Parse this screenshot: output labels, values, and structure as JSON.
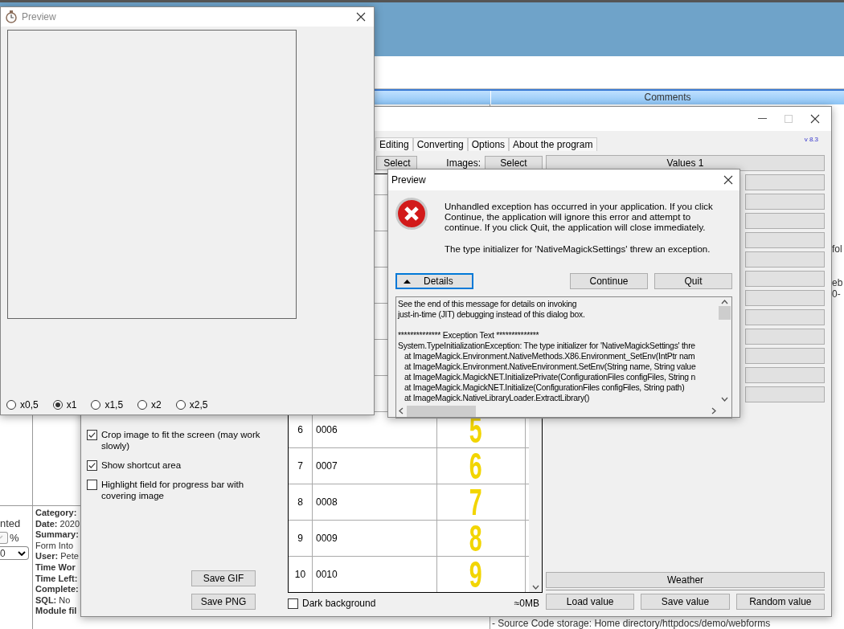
{
  "background_page": {
    "header": {
      "column": "Comments"
    },
    "fragments": [
      "fol",
      "eb",
      "0-"
    ],
    "left_cell": {
      "label": "nted",
      "checked": true,
      "unit": "%",
      "select_value": "0"
    },
    "details": [
      {
        "kind": "label",
        "text": "Category:"
      },
      {
        "kind": "pair",
        "text": "**Date:** 2020"
      },
      {
        "kind": "label",
        "text": "Summary:"
      },
      {
        "kind": "value",
        "text": "Form Into"
      },
      {
        "kind": "pair",
        "text": "**User:** Pete"
      },
      {
        "kind": "label",
        "text": "Time Wor"
      },
      {
        "kind": "label",
        "text": "Time Left:"
      },
      {
        "kind": "label",
        "text": "Complete:"
      },
      {
        "kind": "pair",
        "text": "**SQL:** No"
      },
      {
        "kind": "label",
        "text": "Module fil"
      }
    ],
    "footer_line": "- Source Code storage:  Home directory/httpdocs/demo/webforms"
  },
  "main_window": {
    "version": "v 8.3",
    "tabs": [
      {
        "label": "Editing"
      },
      {
        "label": "Converting"
      },
      {
        "label": "Options"
      },
      {
        "label": "About the program"
      }
    ],
    "toolbar": {
      "select_button": "Select",
      "images_label": "Images:",
      "images_button": "Select"
    },
    "options": [
      {
        "label": "Crop image to fit the screen (may work slowly)",
        "checked": true
      },
      {
        "label": "Show shortcut area",
        "checked": true
      },
      {
        "label": "Highlight field for progress bar with covering image",
        "checked": false
      }
    ],
    "save_buttons": [
      "Save GIF",
      "Save PNG"
    ],
    "table": {
      "rows": [
        {
          "number": "6",
          "code": "0006",
          "digit": "5"
        },
        {
          "number": "7",
          "code": "0007",
          "digit": "6"
        },
        {
          "number": "8",
          "code": "0008",
          "digit": "7"
        },
        {
          "number": "9",
          "code": "0009",
          "digit": "8"
        },
        {
          "number": "10",
          "code": "0010",
          "digit": "9"
        }
      ]
    },
    "dark_background": {
      "label": "Dark background",
      "checked": false
    },
    "memory": "≈0MB",
    "value_buttons": [
      {
        "kind": "labeled",
        "label": "Values 1"
      },
      {
        "kind": "blank"
      },
      {
        "kind": "blank"
      },
      {
        "kind": "blank"
      },
      {
        "kind": "blank"
      },
      {
        "kind": "blank"
      },
      {
        "kind": "blank"
      },
      {
        "kind": "blank"
      },
      {
        "kind": "blank"
      },
      {
        "kind": "blank"
      },
      {
        "kind": "blank"
      },
      {
        "kind": "blank"
      },
      {
        "kind": "blank"
      }
    ],
    "weather_button": "Weather",
    "bottom_buttons": [
      "Load value",
      "Save value",
      "Random value"
    ]
  },
  "preview_window": {
    "title": "Preview",
    "zoom_options": [
      {
        "label": "x0,5",
        "selected": false
      },
      {
        "label": "x1",
        "selected": true
      },
      {
        "label": "x1,5",
        "selected": false
      },
      {
        "label": "x2",
        "selected": false
      },
      {
        "label": "x2,5",
        "selected": false
      }
    ]
  },
  "error_dialog": {
    "title": "Preview",
    "message": "Unhandled exception has occurred in your application. If you click Continue, the application will ignore this error and attempt to continue. If you click Quit, the application will close immediately.",
    "detail": "The type initializer for 'NativeMagickSettings' threw an exception.",
    "details_button": "Details",
    "buttons": [
      "Continue",
      "Quit"
    ],
    "details_lines": [
      "See the end of this message for details on invoking",
      "just-in-time (JIT) debugging instead of this dialog box.",
      "************** Exception Text **************",
      "System.TypeInitializationException: The type initializer for 'NativeMagickSettings' thre",
      "   at ImageMagick.Environment.NativeMethods.X86.Environment_SetEnv(IntPtr nam",
      "   at ImageMagick.Environment.NativeEnvironment.SetEnv(String name, String value",
      "   at ImageMagick.MagickNET.InitializePrivate(ConfigurationFiles configFiles, String n",
      "   at ImageMagick.MagickNET.Initialize(ConfigurationFiles configFiles, String path)",
      "   at ImageMagick.NativeLibraryLoader.ExtractLibrary()"
    ]
  }
}
